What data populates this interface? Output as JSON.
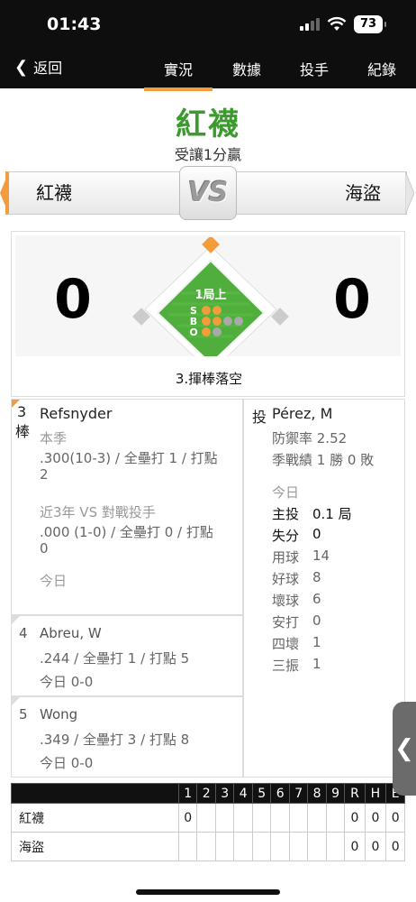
{
  "status": {
    "time": "01:43",
    "battery": "73"
  },
  "nav": {
    "back_label": "返回",
    "tabs": [
      {
        "label": "實況",
        "active": true
      },
      {
        "label": "數據",
        "active": false
      },
      {
        "label": "投手",
        "active": false
      },
      {
        "label": "紀錄",
        "active": false
      }
    ]
  },
  "game": {
    "leader": "紅襪",
    "subtitle": "受讓1分贏",
    "away_team": "紅襪",
    "home_team": "海盜",
    "vs": "VS",
    "away_score": "0",
    "home_score": "0",
    "inning": "1局上",
    "count": {
      "strikes": 2,
      "balls": 2,
      "outs": 1
    },
    "count_labels": [
      "S",
      "B",
      "O"
    ],
    "last_play": "3.揮棒落空"
  },
  "batter": {
    "order_num": "3",
    "order_unit": "棒",
    "name": "Refsnyder",
    "season_label": "本季",
    "season_line1": ".300(10-3) / 全壘打 1 / 打點",
    "season_line2": "2",
    "vs_label": "近3年 VS 對戰投手",
    "vs_line1": ".000 (1-0) / 全壘打 0 / 打點",
    "vs_line2": "0",
    "today_label": "今日"
  },
  "next_batters": [
    {
      "num": "4",
      "name": "Abreu, W",
      "stats": ".244 / 全壘打 1 / 打點 5",
      "today": "今日 0-0"
    },
    {
      "num": "5",
      "name": "Wong",
      "stats": ".349 / 全壘打 3 / 打點 8",
      "today": "今日 0-0"
    }
  ],
  "pitcher": {
    "tag": "投",
    "name": "Pérez, M",
    "era": "防禦率 2.52",
    "record": "季戰績 1 勝 0 敗",
    "today_label": "今日",
    "stats": [
      {
        "label": "主投",
        "value": "0.1 局"
      },
      {
        "label": "失分",
        "value": "0"
      },
      {
        "label": "用球",
        "value": "14"
      },
      {
        "label": "好球",
        "value": "8"
      },
      {
        "label": "壞球",
        "value": "6"
      },
      {
        "label": "安打",
        "value": "0"
      },
      {
        "label": "四壞",
        "value": "1"
      },
      {
        "label": "三振",
        "value": "1"
      }
    ]
  },
  "linescore": {
    "headers": [
      "1",
      "2",
      "3",
      "4",
      "5",
      "6",
      "7",
      "8",
      "9",
      "R",
      "H",
      "E"
    ],
    "rows": [
      {
        "team": "紅襪",
        "cells": [
          "0",
          "",
          "",
          "",
          "",
          "",
          "",
          "",
          "",
          "0",
          "0",
          "0"
        ]
      },
      {
        "team": "海盜",
        "cells": [
          "",
          "",
          "",
          "",
          "",
          "",
          "",
          "",
          "",
          "0",
          "0",
          "0"
        ]
      }
    ]
  },
  "colors": {
    "accent": "#f39c3b",
    "field_green": "#4fae3c",
    "leader_green": "#3c9a2f"
  },
  "icons": {
    "back": "chevron-left-icon",
    "drawer": "chevron-left-icon"
  }
}
